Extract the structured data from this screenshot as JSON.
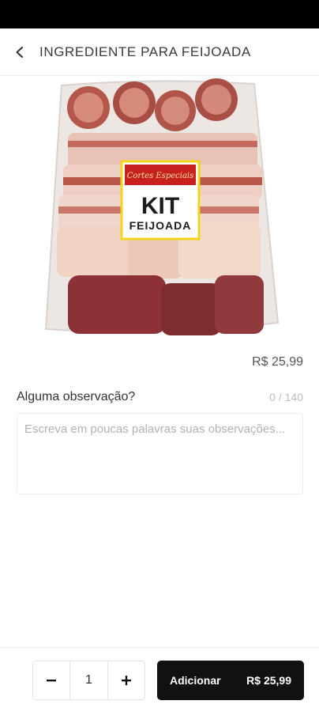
{
  "header": {
    "title": "INGREDIENTE PARA FEIJOADA"
  },
  "product": {
    "label_banner": "Cortes Especiais",
    "label_kit": "KIT",
    "label_name": "FEIJOADA",
    "price": "R$ 25,99"
  },
  "observation": {
    "label": "Alguma observação?",
    "counter": "0 / 140",
    "placeholder": "Escreva em poucas palavras suas observações..."
  },
  "footer": {
    "quantity": "1",
    "add_label": "Adicionar",
    "add_price": "R$ 25,99"
  },
  "colors": {
    "accent": "#111111",
    "label_red": "#c8201e",
    "label_yellow": "#f2d51b"
  }
}
